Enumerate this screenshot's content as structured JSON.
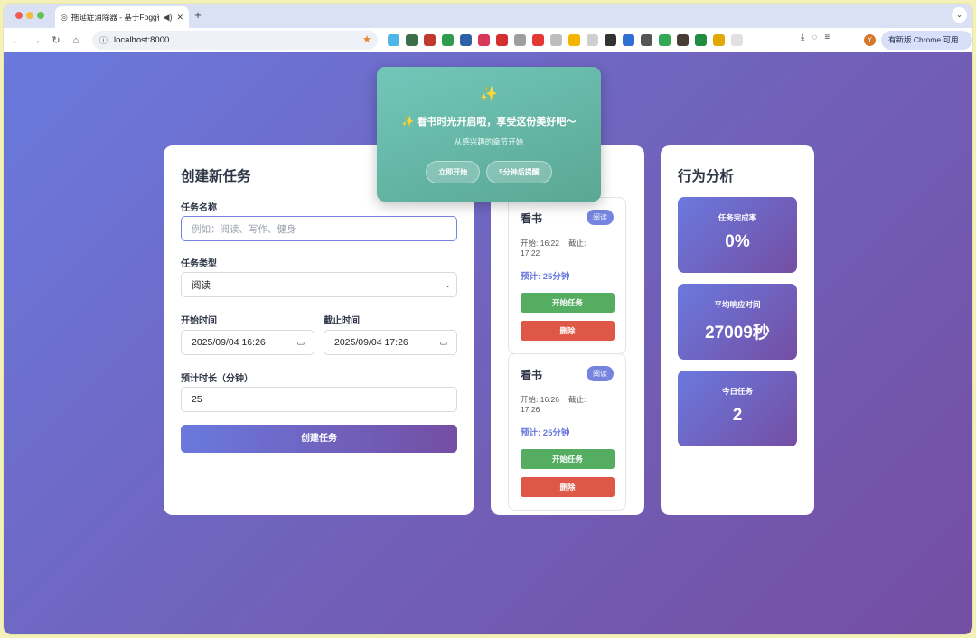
{
  "browser": {
    "tab_title": "拖延症消除器 - 基于Fogg行",
    "url": "localhost:8000",
    "update_label": "有新版 Chrome 可用",
    "avatar_letter": "Y"
  },
  "toast": {
    "icon": "✨",
    "title": "✨ 看书时光开启啦，享受这份美好吧～",
    "subtitle": "从感兴趣的章节开始",
    "start_label": "立即开始",
    "snooze_label": "5分钟后提醒"
  },
  "form": {
    "heading": "创建新任务",
    "name_label": "任务名称",
    "name_placeholder": "例如：阅读、写作、健身",
    "type_label": "任务类型",
    "type_value": "阅读",
    "start_label": "开始时间",
    "start_value": "2025/09/04 16:26",
    "deadline_label": "截止时间",
    "deadline_value": "2025/09/04 17:26",
    "duration_label": "预计时长（分钟）",
    "duration_value": "25",
    "submit_label": "创建任务"
  },
  "tasks": [
    {
      "name": "看书",
      "badge": "阅读",
      "start": "开始: 16:22",
      "deadline": "截止: 17:22",
      "estimate": "预计: 25分钟",
      "start_btn": "开始任务",
      "delete_btn": "删除"
    },
    {
      "name": "看书",
      "badge": "阅读",
      "start": "开始: 16:26",
      "deadline": "截止: 17:26",
      "estimate": "预计: 25分钟",
      "start_btn": "开始任务",
      "delete_btn": "删除"
    }
  ],
  "stats": {
    "heading": "行为分析",
    "items": [
      {
        "label": "任务完成率",
        "value": "0%"
      },
      {
        "label": "平均响应时间",
        "value": "27009秒"
      },
      {
        "label": "今日任务",
        "value": "2"
      }
    ]
  },
  "colors": {
    "accent": "#6a79de",
    "accent_end": "#744ea3",
    "success": "#55ad62",
    "danger": "#de5747",
    "toast": "#5aa794"
  }
}
